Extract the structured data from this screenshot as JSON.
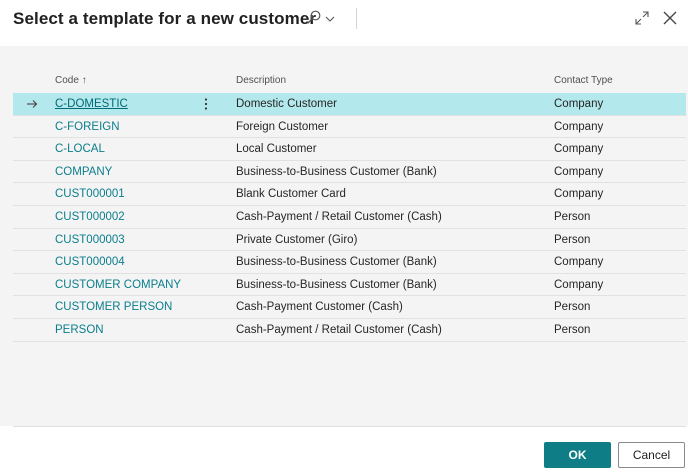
{
  "dialog": {
    "title": "Select a template for a new customer"
  },
  "icons": {
    "search": "search-icon",
    "chevron": "chevron-down-icon",
    "expand": "expand-icon",
    "close": "close-icon",
    "row_indicator": "arrow-right-icon",
    "row_menu": "more-vertical-icon",
    "sort": "sort-ascending-arrow"
  },
  "grid": {
    "headers": {
      "code": "Code",
      "code_sort": "↑",
      "description": "Description",
      "contact_type": "Contact Type"
    },
    "rows": [
      {
        "code": "C-DOMESTIC",
        "description": "Domestic Customer",
        "contact_type": "Company"
      },
      {
        "code": "C-FOREIGN",
        "description": "Foreign Customer",
        "contact_type": "Company"
      },
      {
        "code": "C-LOCAL",
        "description": "Local Customer",
        "contact_type": "Company"
      },
      {
        "code": "COMPANY",
        "description": "Business-to-Business Customer (Bank)",
        "contact_type": "Company"
      },
      {
        "code": "CUST000001",
        "description": "Blank Customer Card",
        "contact_type": "Company"
      },
      {
        "code": "CUST000002",
        "description": "Cash-Payment / Retail Customer (Cash)",
        "contact_type": "Person"
      },
      {
        "code": "CUST000003",
        "description": "Private Customer (Giro)",
        "contact_type": "Person"
      },
      {
        "code": "CUST000004",
        "description": "Business-to-Business Customer (Bank)",
        "contact_type": "Company"
      },
      {
        "code": "CUSTOMER COMPANY",
        "description": "Business-to-Business Customer (Bank)",
        "contact_type": "Company"
      },
      {
        "code": "CUSTOMER PERSON",
        "description": "Cash-Payment Customer (Cash)",
        "contact_type": "Person"
      },
      {
        "code": "PERSON",
        "description": "Cash-Payment / Retail Customer (Cash)",
        "contact_type": "Person"
      }
    ],
    "selected_index": 0
  },
  "footer": {
    "ok_label": "OK",
    "cancel_label": "Cancel"
  },
  "colors": {
    "accent": "#0e7d86",
    "link": "#0a7e8c",
    "selected_row": "#b3e8ec"
  }
}
